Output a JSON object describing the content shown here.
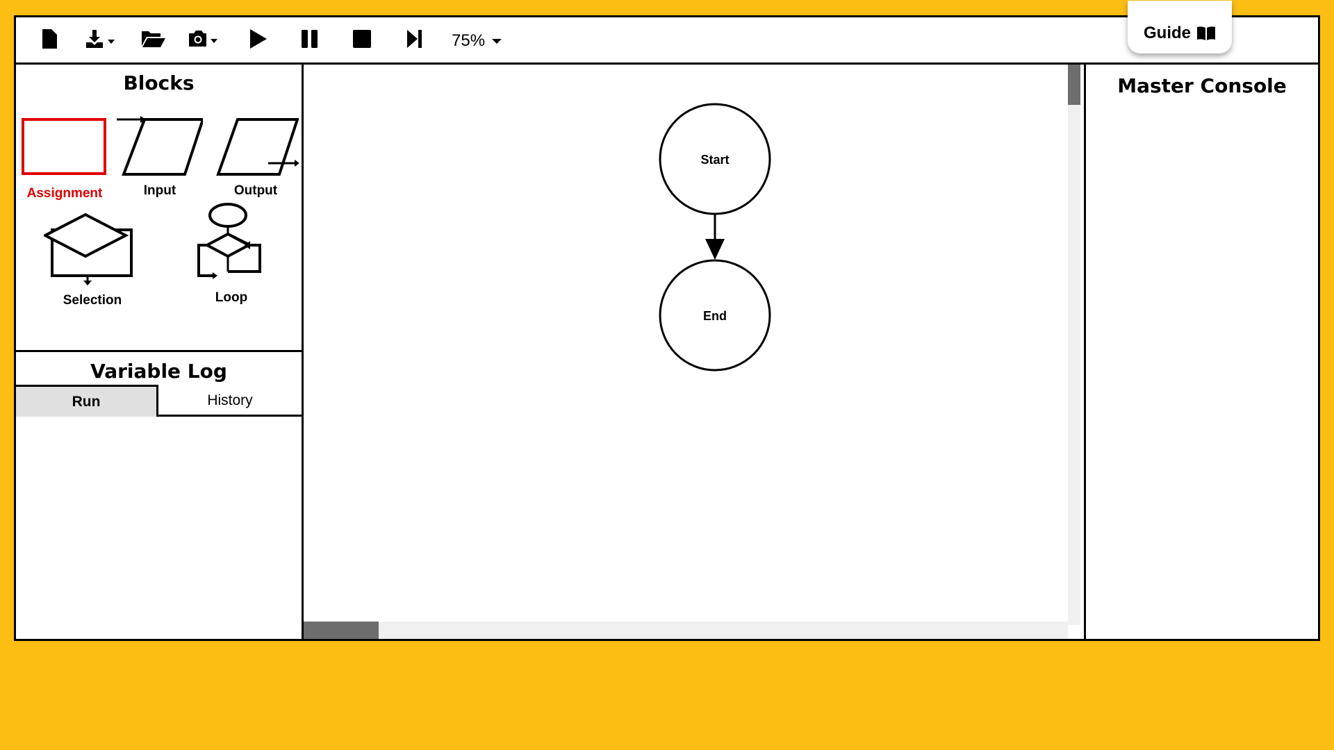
{
  "toolbar": {
    "zoom_value": "75%",
    "guide_label": "Guide",
    "buttons": [
      "new-file",
      "download",
      "open-folder",
      "screenshot",
      "play",
      "pause",
      "stop",
      "step"
    ]
  },
  "blocks": {
    "title": "Blocks",
    "items": [
      {
        "label": "Assignment",
        "selected": true
      },
      {
        "label": "Input"
      },
      {
        "label": "Output"
      },
      {
        "label": "Selection"
      },
      {
        "label": "Loop"
      }
    ]
  },
  "variable_log": {
    "title": "Variable Log",
    "tabs": [
      {
        "label": "Run",
        "active": true
      },
      {
        "label": "History"
      }
    ]
  },
  "flowchart": {
    "nodes": [
      {
        "label": "Start"
      },
      {
        "label": "End"
      }
    ]
  },
  "console": {
    "title": "Master Console"
  },
  "colors": {
    "background": "#FCBE12",
    "selected": "#E00000",
    "scroll_thumb": "#6D6D6D"
  }
}
